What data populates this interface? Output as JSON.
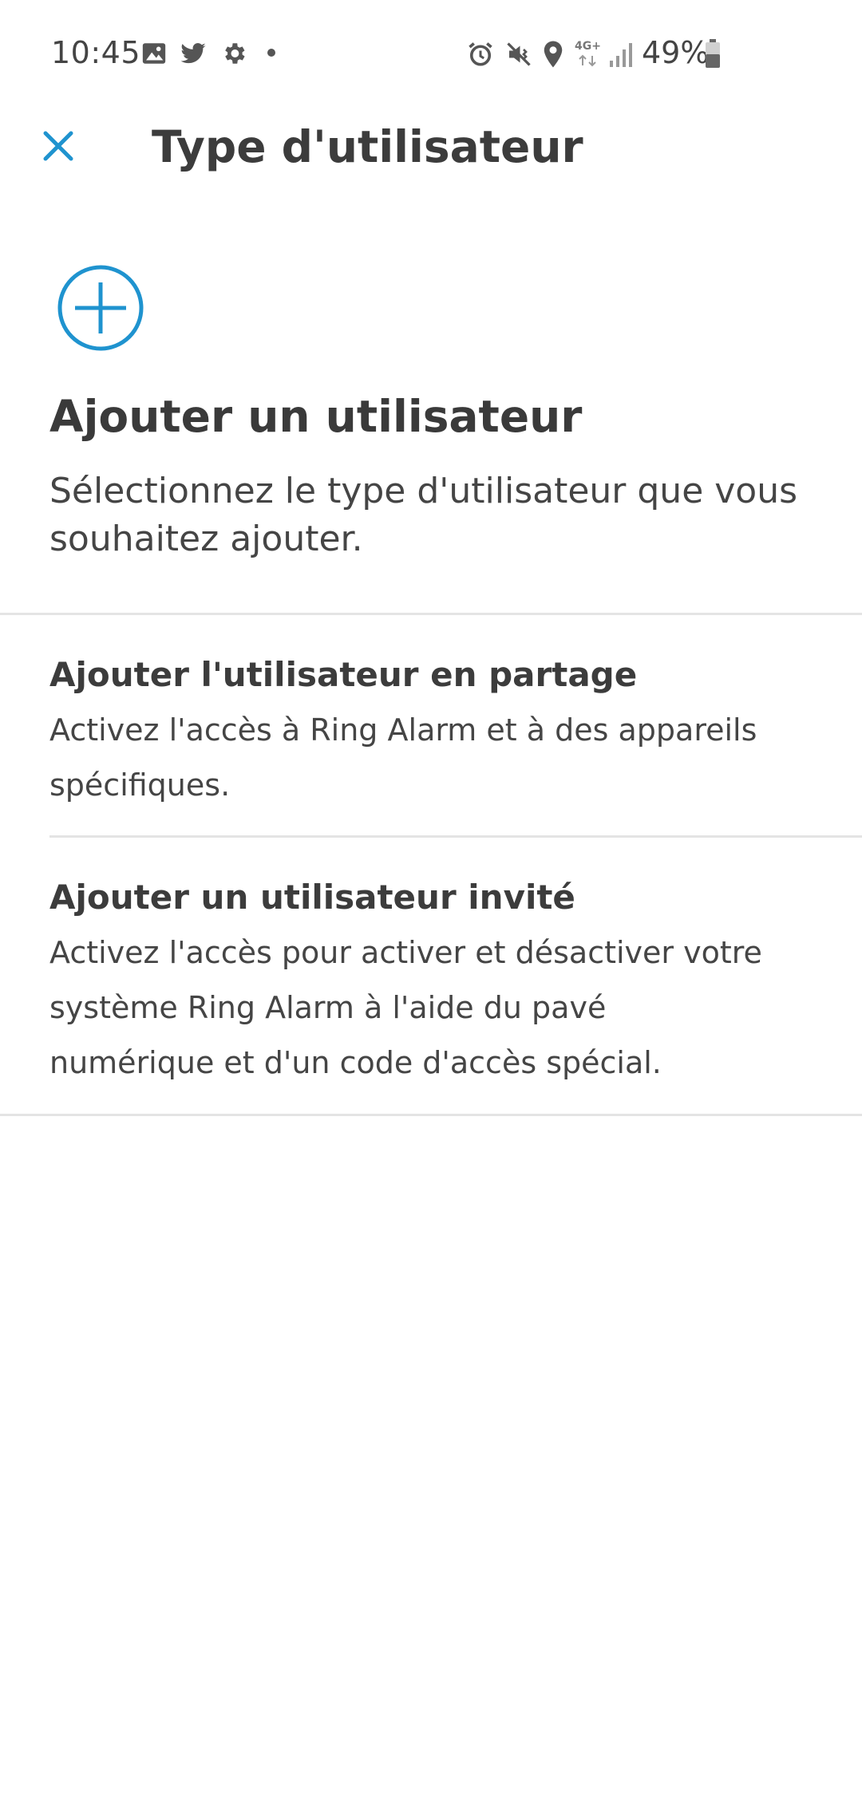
{
  "status_bar": {
    "time": "10:45",
    "battery": "49%",
    "network": "4G+",
    "left_icons": [
      "gallery-icon",
      "twitter-icon",
      "settings-icon",
      "dot-icon"
    ],
    "right_icons": [
      "alarm-icon",
      "mute-vibrate-icon",
      "location-icon",
      "network-4g-icon",
      "signal-icon",
      "battery-icon"
    ]
  },
  "appbar": {
    "title": "Type d'utilisateur",
    "close_icon": "close-icon"
  },
  "hero": {
    "icon": "plus-circle-icon",
    "title": "Ajouter un utilisateur",
    "description": "Sélectionnez le type d'utilisateur que vous souhaitez ajouter."
  },
  "options": [
    {
      "title": "Ajouter l'utilisateur en partage",
      "description": "Activez l'accès à Ring Alarm et à des appareils spécifiques."
    },
    {
      "title": "Ajouter un utilisateur invité",
      "description": "Activez l'accès pour activer et désactiver votre système Ring Alarm à l'aide du pavé numérique et d'un code d'accès spécial."
    }
  ],
  "colors": {
    "accent": "#1f93cf",
    "text": "#3f3f3f",
    "divider": "#e4e4e4"
  }
}
